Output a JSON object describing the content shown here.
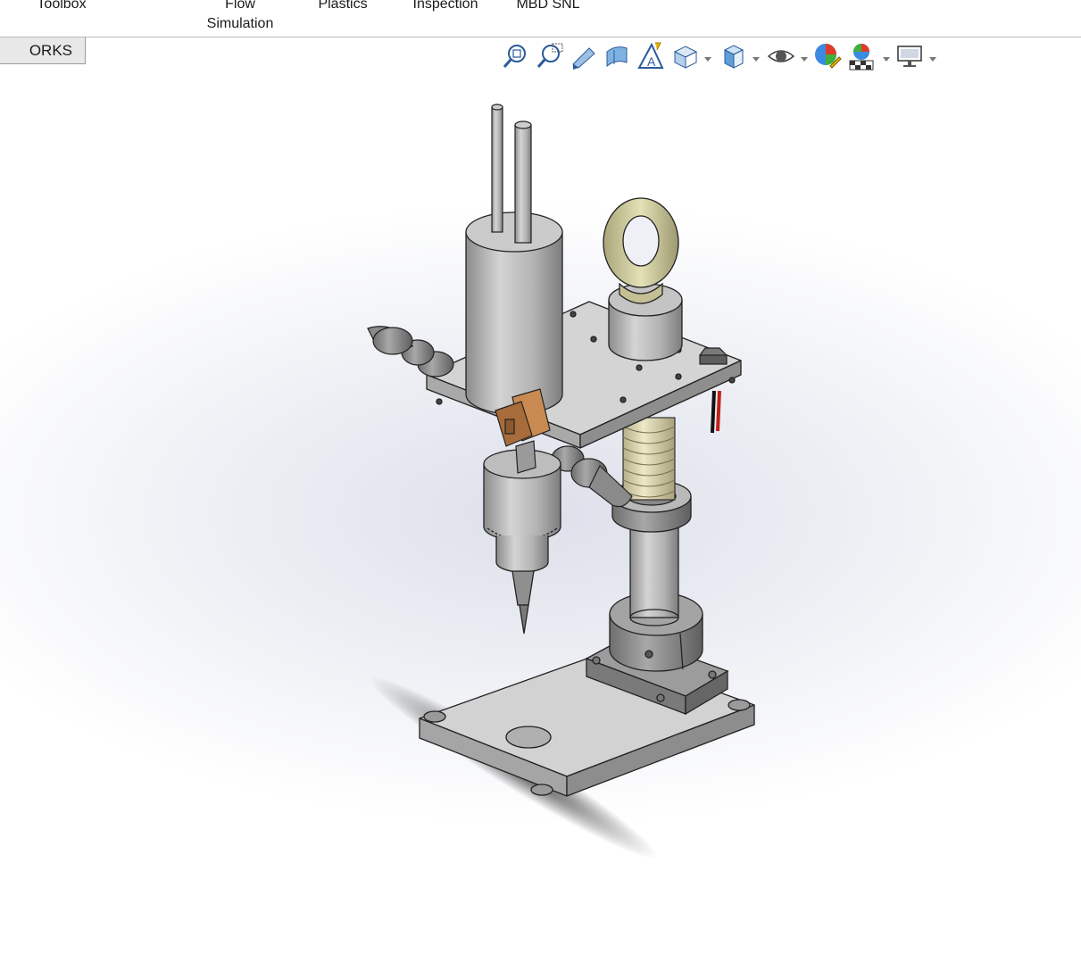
{
  "ribbon": {
    "tabs": [
      {
        "label": "Toolbox"
      },
      {
        "label_line1": "Flow",
        "label_line2": "Simulation"
      },
      {
        "label": "Plastics"
      },
      {
        "label": "Inspection"
      },
      {
        "label": "MBD SNL"
      }
    ]
  },
  "feature_manager": {
    "tab_label": "ORKS CAM"
  },
  "heads_up_toolbar": {
    "icons": [
      "zoom-to-fit-icon",
      "zoom-to-area-icon",
      "previous-view-icon",
      "section-view-icon",
      "dynamic-annotation-views-icon",
      "view-orientation-icon",
      "display-style-icon",
      "hide-show-items-icon",
      "edit-appearance-icon",
      "apply-scene-icon",
      "view-settings-icon"
    ]
  },
  "model": {
    "description_colors": {
      "body": "#c8c8c8",
      "eyebolt": "#d6d3a6",
      "switch": "#c98a52",
      "spring": "#e6dfb8",
      "wire_red": "#c0201a"
    }
  }
}
